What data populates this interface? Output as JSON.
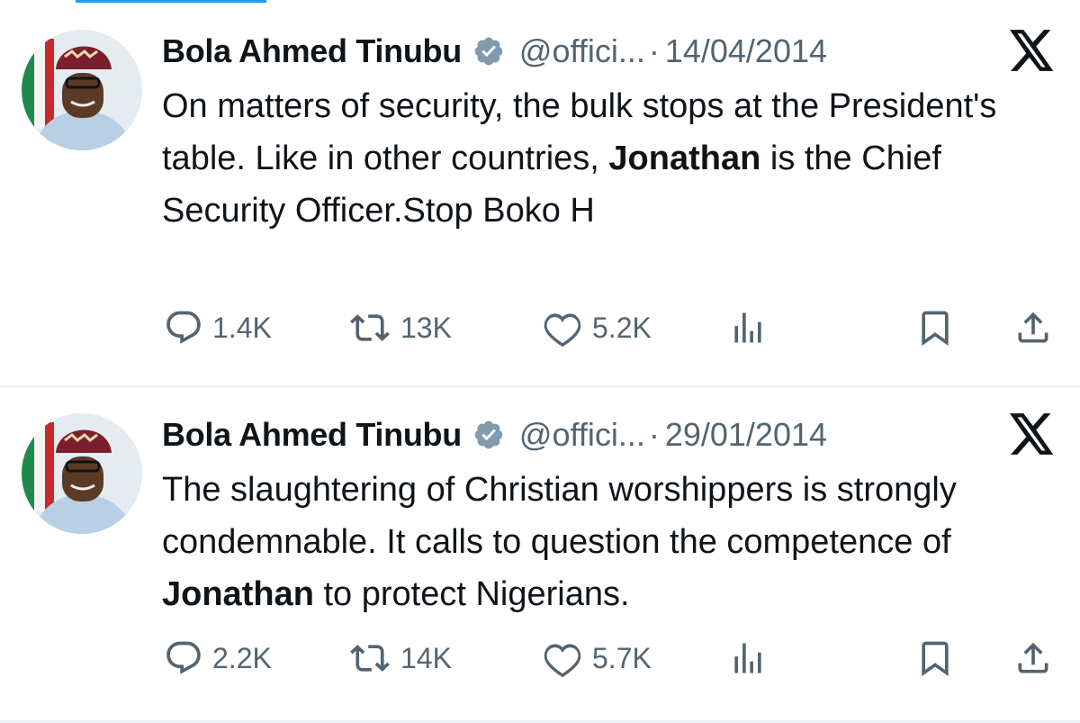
{
  "colors": {
    "accent": "#1d9bf0",
    "text": "#0f1419",
    "muted": "#536471",
    "divider": "#eff3f4"
  },
  "icons": [
    "verified-badge-icon",
    "x-logo-icon",
    "reply-icon",
    "retweet-icon",
    "like-icon",
    "views-icon",
    "bookmark-icon",
    "share-icon"
  ],
  "tweets": [
    {
      "author_name": "Bola Ahmed Tinubu",
      "handle": "@offici...",
      "separator": "·",
      "date": "14/04/2014",
      "text_parts": [
        "On matters of security, the bulk stops at the President's table. Like in other countries, ",
        "Jonathan",
        " is the Chief Security Officer.Stop Boko H"
      ],
      "replies": "1.4K",
      "retweets": "13K",
      "likes": "5.2K"
    },
    {
      "author_name": "Bola Ahmed Tinubu",
      "handle": "@offici...",
      "separator": "·",
      "date": "29/01/2014",
      "text_parts": [
        "The slaughtering of Christian worshippers  is strongly condemnable. It calls to question the competence of ",
        "Jonathan",
        " to protect Nigerians."
      ],
      "replies": "2.2K",
      "retweets": "14K",
      "likes": "5.7K"
    }
  ]
}
